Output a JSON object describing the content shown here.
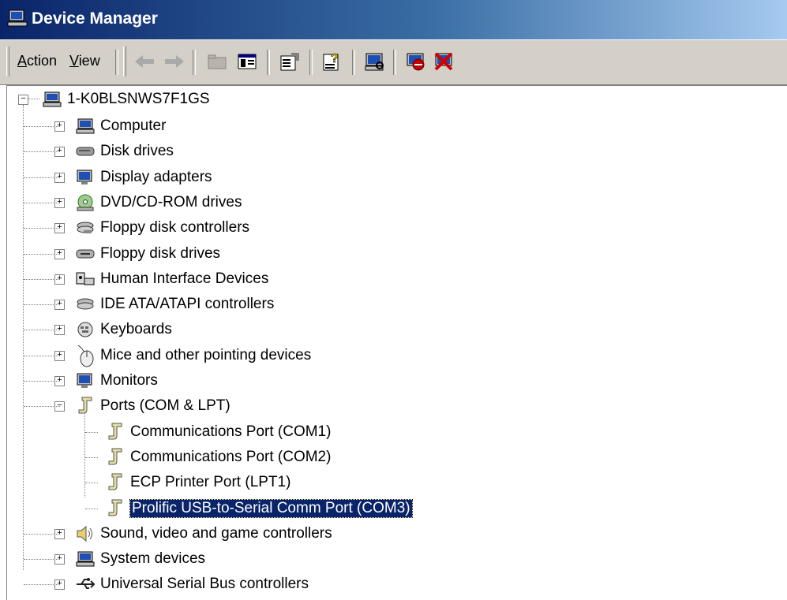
{
  "window": {
    "title": "Device Manager",
    "title_icon": "computer-manage-icon"
  },
  "menu": [
    {
      "label": "Action",
      "accel": "A",
      "rest": "ction"
    },
    {
      "label": "View",
      "accel": "V",
      "rest": "iew"
    }
  ],
  "toolbar": {
    "buttons": [
      {
        "name": "back-arrow-icon"
      },
      {
        "name": "forward-arrow-icon"
      },
      {
        "name": "up-folder-icon"
      },
      {
        "name": "show-hide-tree-icon"
      },
      {
        "name": "properties-icon"
      },
      {
        "name": "help-icon"
      },
      {
        "name": "scan-hardware-icon"
      },
      {
        "name": "disable-device-icon"
      },
      {
        "name": "uninstall-device-icon"
      }
    ]
  },
  "tree": {
    "root": "1-K0BLSNWS7F1GS",
    "categories": [
      {
        "label": "Computer",
        "icon": "computer-icon"
      },
      {
        "label": "Disk drives",
        "icon": "disk-drive-icon"
      },
      {
        "label": "Display adapters",
        "icon": "display-adapter-icon"
      },
      {
        "label": "DVD/CD-ROM drives",
        "icon": "cdrom-icon"
      },
      {
        "label": "Floppy disk controllers",
        "icon": "controller-icon"
      },
      {
        "label": "Floppy disk drives",
        "icon": "floppy-drive-icon"
      },
      {
        "label": "Human Interface Devices",
        "icon": "hid-icon"
      },
      {
        "label": "IDE ATA/ATAPI controllers",
        "icon": "ide-controller-icon"
      },
      {
        "label": "Keyboards",
        "icon": "keyboard-icon"
      },
      {
        "label": "Mice and other pointing devices",
        "icon": "mouse-icon"
      },
      {
        "label": "Monitors",
        "icon": "monitor-icon"
      },
      {
        "label": "Ports (COM & LPT)",
        "icon": "port-icon"
      }
    ],
    "ports": [
      {
        "label": "Communications Port (COM1)"
      },
      {
        "label": "Communications Port (COM2)"
      },
      {
        "label": "ECP Printer Port (LPT1)"
      },
      {
        "label": "Prolific USB-to-Serial Comm Port (COM3)",
        "selected": true
      }
    ],
    "after": [
      {
        "label": "Sound, video and game controllers",
        "icon": "speaker-icon"
      },
      {
        "label": "System devices",
        "icon": "system-devices-icon"
      },
      {
        "label": "Universal Serial Bus controllers",
        "icon": "usb-icon"
      }
    ]
  },
  "colors": {
    "title_start": "#0a246a",
    "title_end": "#a6caf0",
    "selection": "#0a246a",
    "face": "#d4d0c8"
  }
}
